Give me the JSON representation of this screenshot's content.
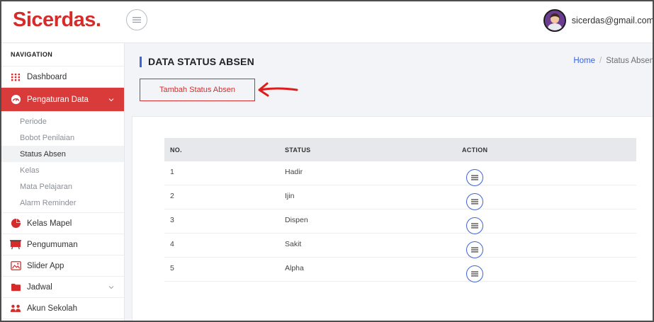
{
  "app": {
    "brand": "Sicerdas.",
    "user_email": "sicerdas@gmail.com"
  },
  "colors": {
    "brand_red": "#d62b2b",
    "active_nav": "#d93a3a",
    "accent_blue": "#3b64d8"
  },
  "sidebar": {
    "heading": "NAVIGATION",
    "items": [
      {
        "label": "Dashboard",
        "icon": "grid-dots-icon"
      },
      {
        "label": "Pengaturan Data",
        "icon": "gauge-icon",
        "active": true
      },
      {
        "label": "Kelas Mapel",
        "icon": "pie-chart-icon"
      },
      {
        "label": "Pengumuman",
        "icon": "presentation-board-icon"
      },
      {
        "label": "Slider App",
        "icon": "image-gallery-icon"
      },
      {
        "label": "Jadwal",
        "icon": "folder-icon"
      },
      {
        "label": "Akun Sekolah",
        "icon": "users-icon"
      }
    ],
    "submenu": [
      {
        "label": "Periode"
      },
      {
        "label": "Bobot Penilaian"
      },
      {
        "label": "Status Absen",
        "current": true
      },
      {
        "label": "Kelas"
      },
      {
        "label": "Mata Pelajaran"
      },
      {
        "label": "Alarm Reminder"
      }
    ]
  },
  "page": {
    "title": "DATA STATUS ABSEN",
    "breadcrumb": {
      "home": "Home",
      "separator": "/",
      "current": "Status Absen"
    },
    "add_button": "Tambah Status Absen"
  },
  "table": {
    "headers": {
      "no": "NO.",
      "status": "STATUS",
      "action": "ACTION"
    },
    "rows": [
      {
        "no": "1",
        "status": "Hadir"
      },
      {
        "no": "2",
        "status": "Ijin"
      },
      {
        "no": "3",
        "status": "Dispen"
      },
      {
        "no": "4",
        "status": "Sakit"
      },
      {
        "no": "5",
        "status": "Alpha"
      }
    ]
  }
}
